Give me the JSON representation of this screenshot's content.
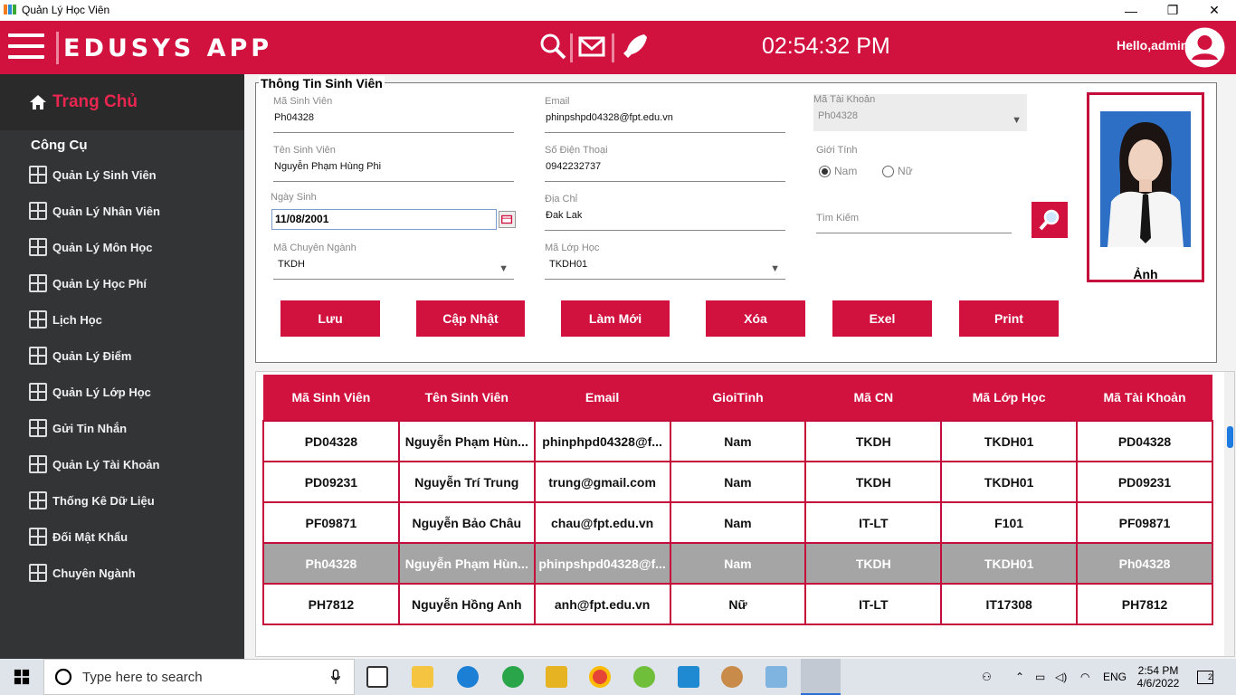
{
  "window": {
    "title": "Quản Lý Học Viên",
    "minimize": "—",
    "restore": "❐",
    "close": "✕"
  },
  "header": {
    "brand": "EDUSYS APP",
    "clock": "02:54:32 PM",
    "greeting": "Hello,admin"
  },
  "sidebar": {
    "home": "Trang Chủ",
    "section": "Công Cụ",
    "items": [
      {
        "label": "Quản Lý Sinh Viên"
      },
      {
        "label": "Quản Lý Nhân Viên"
      },
      {
        "label": "Quản Lý Môn Học"
      },
      {
        "label": "Quản Lý Học Phí"
      },
      {
        "label": "Lịch Học"
      },
      {
        "label": "Quản Lý Điểm"
      },
      {
        "label": "Quản Lý Lớp Học"
      },
      {
        "label": "Gửi Tin Nhắn"
      },
      {
        "label": "Quản Lý Tài Khoản"
      },
      {
        "label": "Thống Kê Dữ Liệu"
      },
      {
        "label": "Đối Mật Khẩu"
      },
      {
        "label": "Chuyên Ngành"
      }
    ]
  },
  "form": {
    "legend": "Thông Tin Sinh Viên",
    "student_id": {
      "label": "Mã Sinh Viên",
      "value": "Ph04328"
    },
    "email": {
      "label": "Email",
      "value": "phinpshpd04328@fpt.edu.vn"
    },
    "account_id": {
      "label": "Mã Tài Khoản",
      "value": "Ph04328"
    },
    "name": {
      "label": "Tên Sinh Viên",
      "value": "Nguyễn Phạm Hùng Phi"
    },
    "phone": {
      "label": "Số Điện Thoại",
      "value": "0942232737"
    },
    "gender": {
      "label": "Giới Tính",
      "male": "Nam",
      "female": "Nữ",
      "selected": "Nam"
    },
    "dob": {
      "label": "Ngày Sinh",
      "value": "11/08/2001"
    },
    "address": {
      "label": "Địa Chỉ",
      "value": "Đak Lak"
    },
    "search": {
      "label": "Tìm Kiếm",
      "value": ""
    },
    "major": {
      "label": "Mã Chuyên Ngành",
      "value": "TKDH"
    },
    "class": {
      "label": "Mã Lớp Học",
      "value": "TKDH01"
    },
    "photo_caption": "Ảnh",
    "buttons": {
      "save": "Lưu",
      "update": "Cập Nhật",
      "reset": "Làm Mới",
      "delete": "Xóa",
      "excel": "Exel",
      "print": "Print"
    }
  },
  "table": {
    "headers": [
      "Mã Sinh Viên",
      "Tên Sinh Viên",
      "Email",
      "GioiTinh",
      "Mã CN",
      "Mã Lớp Học",
      "Mã Tài Khoản"
    ],
    "rows": [
      [
        "PD04328",
        "Nguyễn Phạm Hùn...",
        "phinphpd04328@f...",
        "Nam",
        "TKDH",
        "TKDH01",
        "PD04328"
      ],
      [
        "PD09231",
        "Nguyễn Trí Trung",
        "trung@gmail.com",
        "Nam",
        "TKDH",
        "TKDH01",
        "PD09231"
      ],
      [
        "PF09871",
        "Nguyễn Bảo Châu",
        "chau@fpt.edu.vn",
        "Nam",
        "IT-LT",
        "F101",
        "PF09871"
      ],
      [
        "Ph04328",
        "Nguyễn Phạm Hùn...",
        "phinpshpd04328@f...",
        "Nam",
        "TKDH",
        "TKDH01",
        "Ph04328"
      ],
      [
        "PH7812",
        "Nguyễn Hồng Anh",
        "anh@fpt.edu.vn",
        "Nữ",
        "IT-LT",
        "IT17308",
        "PH7812"
      ]
    ],
    "selected_row": 3
  },
  "taskbar": {
    "search_placeholder": "Type here to search",
    "time": "2:54 PM",
    "date": "4/6/2022",
    "lang": "ENG",
    "notifications": "2"
  },
  "colors": {
    "brand": "#d1123f",
    "sidebar": "#333435",
    "selected_row": "#a5a5a5"
  }
}
